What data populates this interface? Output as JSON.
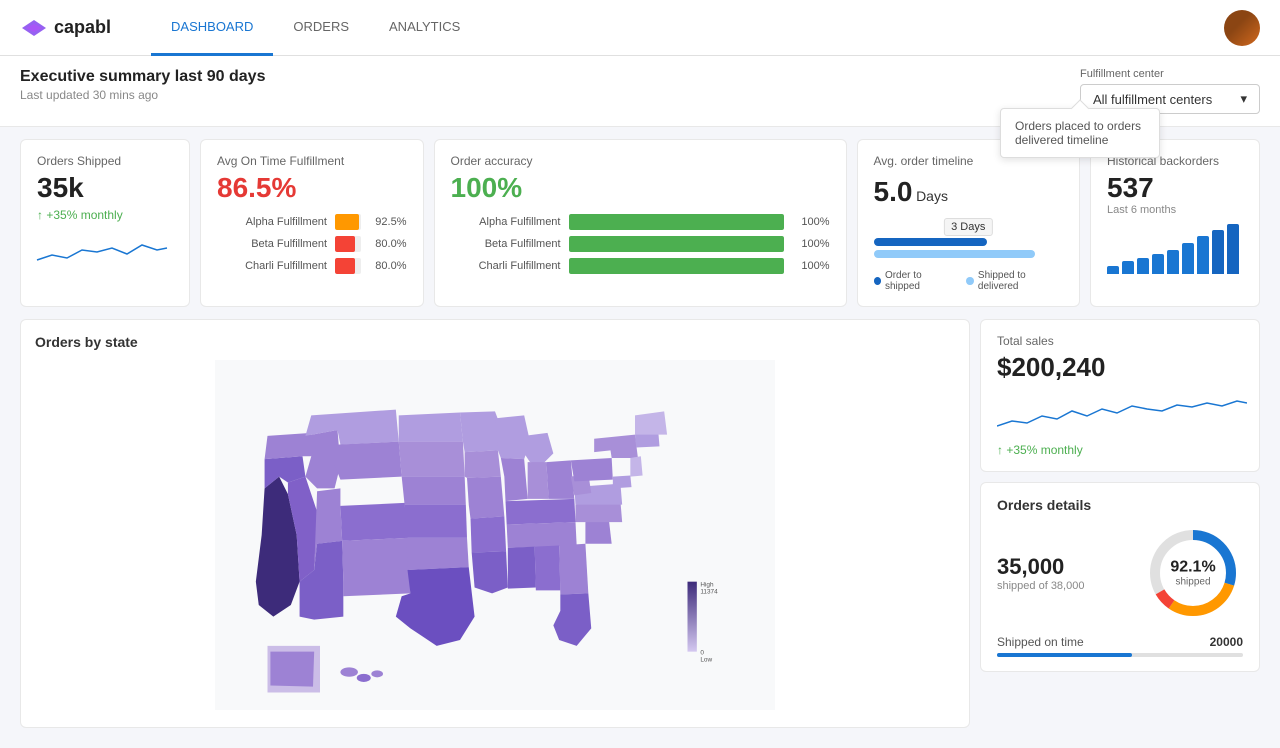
{
  "header": {
    "logo_text": "capabl",
    "nav": [
      {
        "label": "DASHBOARD",
        "active": true
      },
      {
        "label": "ORDERS",
        "active": false
      },
      {
        "label": "ANALYTICS",
        "active": false
      }
    ]
  },
  "summary": {
    "title": "Executive summary last 90 days",
    "last_updated": "Last updated 30 mins ago",
    "fulfillment_label": "Fulfillment center",
    "fulfillment_value": "All fulfillment centers"
  },
  "tooltip": {
    "text": "Orders placed to orders delivered timeline"
  },
  "metrics": {
    "orders_shipped": {
      "title": "Orders Shipped",
      "value": "35k",
      "trend": "+35% monthly"
    },
    "avg_on_time": {
      "title": "Avg On Time Fulfillment",
      "value": "86.5%",
      "rows": [
        {
          "name": "Alpha Fulfillment",
          "pct": "92.5%",
          "fill": 92.5,
          "color": "#ff9800"
        },
        {
          "name": "Beta Fulfillment",
          "pct": "80.0%",
          "fill": 80,
          "color": "#f44336"
        },
        {
          "name": "Charli Fulfillment",
          "pct": "80.0%",
          "fill": 80,
          "color": "#f44336"
        }
      ]
    },
    "order_accuracy": {
      "title": "Order accuracy",
      "value": "100%",
      "rows": [
        {
          "name": "Alpha Fulfillment",
          "pct": "100%",
          "fill": 100
        },
        {
          "name": "Beta Fulfillment",
          "pct": "100%",
          "fill": 100
        },
        {
          "name": "Charli Fulfillment",
          "pct": "100%",
          "fill": 100
        }
      ]
    },
    "avg_order_timeline": {
      "title": "Avg. order timeline",
      "value": "5.0",
      "unit": "Days",
      "tag": "3 Days",
      "legend": [
        {
          "label": "Order to shipped",
          "color": "#1565c0"
        },
        {
          "label": "Shipped to delivered",
          "color": "#90caf9"
        }
      ]
    },
    "historical_backorders": {
      "title": "Historical backorders",
      "value": "537",
      "subtitle": "Last 6 months",
      "bars": [
        8,
        12,
        15,
        18,
        22,
        30,
        38,
        45,
        50
      ]
    }
  },
  "map": {
    "title": "Orders by state",
    "legend_high": "High",
    "legend_value": "11374",
    "legend_low": "0",
    "legend_label": "Low"
  },
  "total_sales": {
    "title": "Total sales",
    "value": "$200,240",
    "trend": "+35% monthly"
  },
  "orders_details": {
    "title": "Orders details",
    "count": "35,000",
    "subtitle": "shipped of 38,000",
    "pct": "92.1%",
    "pct_label": "shipped",
    "shipped_on_time_label": "Shipped on time",
    "shipped_on_time_value": "20000",
    "shipped_on_time_pct": 55
  }
}
